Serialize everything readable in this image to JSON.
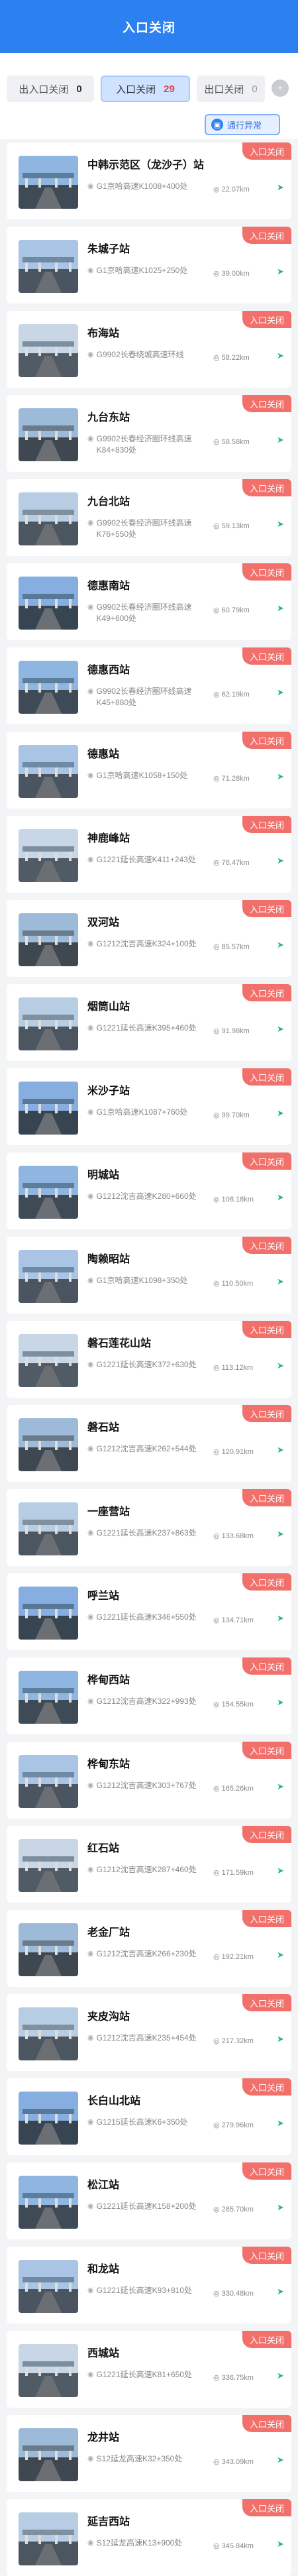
{
  "header": {
    "title": "入口关闭"
  },
  "filters": {
    "entrance_closed": {
      "label": "出入口关闭",
      "count": "0"
    },
    "entry_closed": {
      "label": "入口关闭",
      "count": "29"
    },
    "exit_closed": {
      "label": "出口关闭",
      "count": "0"
    },
    "traffic_button": "通行异常"
  },
  "colors": {
    "primary": "#2d80f0",
    "badge": "#f1706b",
    "nav": "#2bb673"
  },
  "stations": [
    {
      "name": "中韩示范区（龙沙子）站",
      "location": "G1京哈高速K1008+400处",
      "distance": "22.07km",
      "status": "入口关闭"
    },
    {
      "name": "朱城子站",
      "location": "G1京哈高速K1025+250处",
      "distance": "39.00km",
      "status": "入口关闭"
    },
    {
      "name": "布海站",
      "location": "G9902长春绕城高速环线",
      "distance": "58.22km",
      "status": "入口关闭"
    },
    {
      "name": "九台东站",
      "location": "G9902长春经济圈环线高速K84+830处",
      "distance": "58.58km",
      "status": "入口关闭"
    },
    {
      "name": "九台北站",
      "location": "G9902长春经济圈环线高速K76+550处",
      "distance": "59.13km",
      "status": "入口关闭"
    },
    {
      "name": "德惠南站",
      "location": "G9902长春经济圈环线高速K49+600处",
      "distance": "60.79km",
      "status": "入口关闭"
    },
    {
      "name": "德惠西站",
      "location": "G9902长春经济圈环线高速K45+880处",
      "distance": "62.19km",
      "status": "入口关闭"
    },
    {
      "name": "德惠站",
      "location": "G1京哈高速K1058+150处",
      "distance": "71.28km",
      "status": "入口关闭"
    },
    {
      "name": "神鹿峰站",
      "location": "G1221延长高速K411+243处",
      "distance": "76.47km",
      "status": "入口关闭"
    },
    {
      "name": "双河站",
      "location": "G1212沈吉高速K324+100处",
      "distance": "85.57km",
      "status": "入口关闭"
    },
    {
      "name": "烟筒山站",
      "location": "G1221延长高速K395+460处",
      "distance": "91.98km",
      "status": "入口关闭"
    },
    {
      "name": "米沙子站",
      "location": "G1京哈高速K1087+760处",
      "distance": "99.70km",
      "status": "入口关闭"
    },
    {
      "name": "明城站",
      "location": "G1212沈吉高速K280+660处",
      "distance": "108.18km",
      "status": "入口关闭"
    },
    {
      "name": "陶赖昭站",
      "location": "G1京哈高速K1098+350处",
      "distance": "110.50km",
      "status": "入口关闭"
    },
    {
      "name": "磐石莲花山站",
      "location": "G1221延长高速K372+630处",
      "distance": "113.12km",
      "status": "入口关闭"
    },
    {
      "name": "磐石站",
      "location": "G1212沈吉高速K262+544处",
      "distance": "120.91km",
      "status": "入口关闭"
    },
    {
      "name": "一座营站",
      "location": "G1221延长高速K237+863处",
      "distance": "133.68km",
      "status": "入口关闭"
    },
    {
      "name": "呼兰站",
      "location": "G1221延长高速K346+550处",
      "distance": "134.71km",
      "status": "入口关闭"
    },
    {
      "name": "桦甸西站",
      "location": "G1212沈吉高速K322+993处",
      "distance": "154.55km",
      "status": "入口关闭"
    },
    {
      "name": "桦甸东站",
      "location": "G1212沈吉高速K303+767处",
      "distance": "165.26km",
      "status": "入口关闭"
    },
    {
      "name": "红石站",
      "location": "G1212沈吉高速K287+460处",
      "distance": "171.59km",
      "status": "入口关闭"
    },
    {
      "name": "老金厂站",
      "location": "G1212沈吉高速K266+230处",
      "distance": "192.21km",
      "status": "入口关闭"
    },
    {
      "name": "夹皮沟站",
      "location": "G1212沈吉高速K235+454处",
      "distance": "217.32km",
      "status": "入口关闭"
    },
    {
      "name": "长白山北站",
      "location": "G1215延长高速K6+350处",
      "distance": "279.96km",
      "status": "入口关闭"
    },
    {
      "name": "松江站",
      "location": "G1221延长高速K158+200处",
      "distance": "285.70km",
      "status": "入口关闭"
    },
    {
      "name": "和龙站",
      "location": "G1221延长高速K93+810处",
      "distance": "330.48km",
      "status": "入口关闭"
    },
    {
      "name": "西城站",
      "location": "G1221延长高速K81+650处",
      "distance": "336.75km",
      "status": "入口关闭"
    },
    {
      "name": "龙井站",
      "location": "S12延龙高速K32+350处",
      "distance": "343.09km",
      "status": "入口关闭"
    },
    {
      "name": "延吉西站",
      "location": "S12延龙高速K13+900处",
      "distance": "345.84km",
      "status": "入口关闭"
    }
  ]
}
